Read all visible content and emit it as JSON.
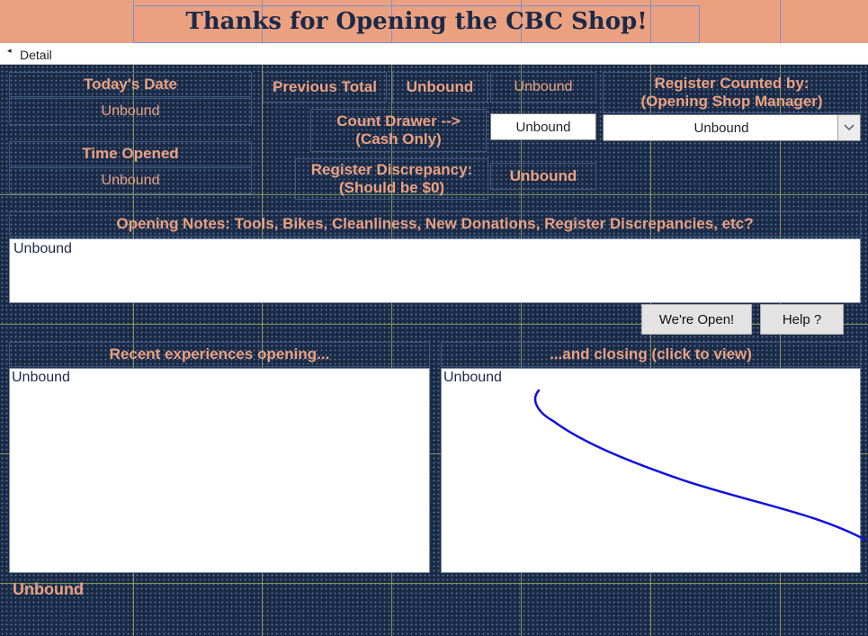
{
  "header": {
    "title": "Thanks for Opening the CBC Shop!"
  },
  "section": {
    "detail_label": "Detail",
    "detail_marker": "◂"
  },
  "labels": {
    "todays_date": "Today's Date",
    "time_opened": "Time Opened",
    "previous_total": "Previous Total",
    "count_drawer": "Count Drawer -->\n(Cash Only)",
    "register_discrepancy": "Register Discrepancy:\n(Should be $0)",
    "register_counted_by": "Register Counted by:\n(Opening Shop Manager)",
    "opening_notes": "Opening Notes: Tools, Bikes, Cleanliness, New Donations, Register Discrepancies, etc?",
    "recent_opening": "Recent experiences opening...",
    "and_closing": "...and closing  (click to view)"
  },
  "values": {
    "todays_date": "Unbound",
    "time_opened": "Unbound",
    "previous_total_a": "Unbound",
    "previous_total_b": "Unbound",
    "count_drawer_input": "Unbound",
    "manager_select": "Unbound",
    "register_discrepancy": "Unbound",
    "opening_notes": "Unbound",
    "recent_opening": "Unbound",
    "recent_closing": "Unbound",
    "footer": "Unbound"
  },
  "buttons": {
    "were_open": "We're Open!",
    "help": "Help ?"
  },
  "icons": {
    "dropdown": "chevron-down-icon"
  },
  "colors": {
    "header_bg": "#eba180",
    "body_bg": "#1a2b48",
    "label_text": "#eba180",
    "title_text": "#1b2a4a",
    "annotation_stroke": "#1010e0"
  }
}
